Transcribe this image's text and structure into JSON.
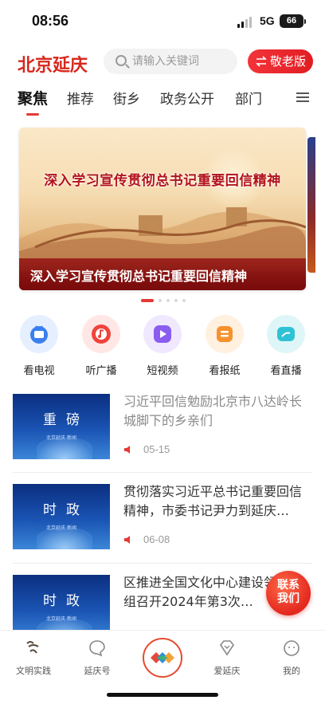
{
  "status_bar": {
    "time": "08:56",
    "network": "5G",
    "battery": "66"
  },
  "header": {
    "logo": "北京延庆",
    "search_placeholder": "请输入关键词",
    "elder_mode": "敬老版"
  },
  "tabs": [
    "聚焦",
    "推荐",
    "街乡",
    "政务公开",
    "部门"
  ],
  "active_tab": "聚焦",
  "banner": {
    "headline": "深入学习宣传贯彻总书记重要回信精神",
    "caption": "深入学习宣传贯彻总书记重要回信精神",
    "page_count": 5,
    "active_page": 1
  },
  "quick_links": [
    {
      "label": "看电视",
      "icon": "tv-icon",
      "color": "#3b7ff0"
    },
    {
      "label": "听广播",
      "icon": "radio-icon",
      "color": "#f0433b"
    },
    {
      "label": "短视频",
      "icon": "video-icon",
      "color": "#8a5cf0"
    },
    {
      "label": "看报纸",
      "icon": "newspaper-icon",
      "color": "#f5922e"
    },
    {
      "label": "看直播",
      "icon": "live-icon",
      "color": "#2fc2d6"
    }
  ],
  "news": [
    {
      "thumb_title": "重磅",
      "thumb_sub": "北京延庆 新闻",
      "title": "习近平回信勉励北京市八达岭长城脚下的乡亲们",
      "date": "05-15",
      "read": true
    },
    {
      "thumb_title": "时政",
      "thumb_sub": "北京延庆 新闻",
      "title": "贯彻落实习近平总书记重要回信精神，市委书记尹力到延庆…",
      "date": "06-08",
      "read": false
    },
    {
      "thumb_title": "时政",
      "thumb_sub": "北京延庆 新闻",
      "title": "区推进全国文化中心建设领导小组召开2024年第3次…",
      "date": "",
      "read": false
    }
  ],
  "contact": {
    "line1": "联系",
    "line2": "我们"
  },
  "bottom_nav": [
    {
      "label": "文明实践",
      "icon": "civilization-icon"
    },
    {
      "label": "延庆号",
      "icon": "chat-bubble-icon"
    },
    {
      "label": "",
      "icon": "home-logo-icon"
    },
    {
      "label": "爱延庆",
      "icon": "diamond-icon"
    },
    {
      "label": "我的",
      "icon": "profile-icon"
    }
  ]
}
